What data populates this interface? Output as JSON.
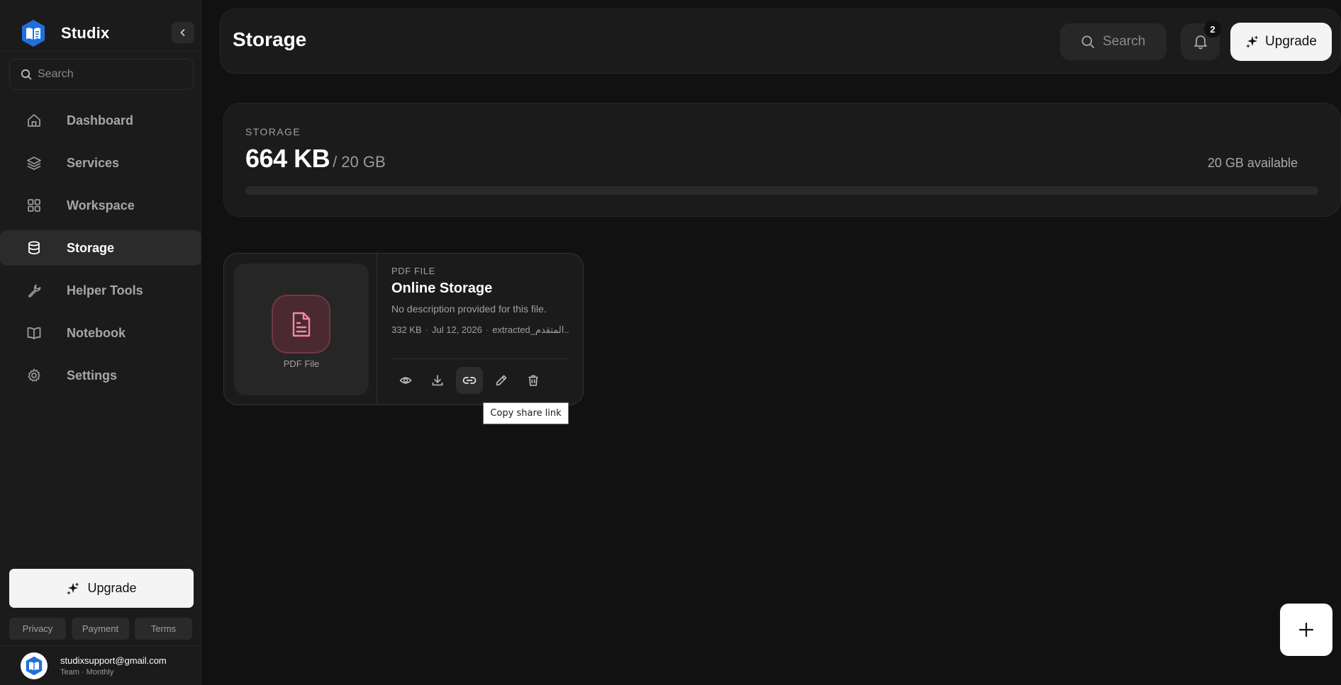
{
  "brand": {
    "name": "Studix"
  },
  "sidebar": {
    "search_placeholder": "Search",
    "items": [
      {
        "label": "Dashboard",
        "icon": "home-icon"
      },
      {
        "label": "Services",
        "icon": "layers-icon"
      },
      {
        "label": "Workspace",
        "icon": "grid-icon"
      },
      {
        "label": "Storage",
        "icon": "database-icon",
        "active": true
      },
      {
        "label": "Helper Tools",
        "icon": "wrench-icon"
      },
      {
        "label": "Notebook",
        "icon": "book-icon"
      },
      {
        "label": "Settings",
        "icon": "gear-icon"
      }
    ],
    "upgrade_label": "Upgrade",
    "legal": {
      "privacy": "Privacy",
      "payment": "Payment",
      "terms": "Terms"
    },
    "account": {
      "email": "studixsupport@gmail.com",
      "plan": "Team · Monthly"
    }
  },
  "header": {
    "title": "Storage",
    "search_placeholder": "Search",
    "notification_count": "2",
    "upgrade_label": "Upgrade"
  },
  "storage": {
    "eyebrow": "STORAGE",
    "used": "664 KB",
    "total": "/ 20 GB",
    "available": "20 GB available",
    "used_fraction": 3e-05
  },
  "file": {
    "preview_label": "PDF File",
    "type": "PDF FILE",
    "name": "Online Storage",
    "description": "No description provided for this file.",
    "size": "332 KB",
    "date": "Jul 12, 2026",
    "source": "extracted_المتقدم...",
    "actions": [
      "view",
      "download",
      "copy-link",
      "edit",
      "delete"
    ]
  },
  "tooltip": {
    "text": "Copy share link"
  },
  "colors": {
    "background": "#111111",
    "panel": "#1b1b1b",
    "accent_pdf": "#f08aa0",
    "brand_blue": "#1f6fe0"
  }
}
